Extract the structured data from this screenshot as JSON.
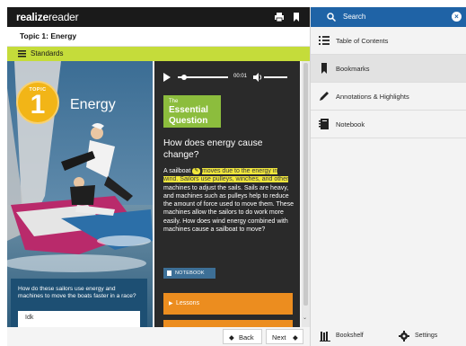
{
  "app": {
    "logo_bold": "realize",
    "logo_thin": "reader"
  },
  "topbar": {
    "print_icon": "printer-icon",
    "bookmark_icon": "bookmark-icon"
  },
  "topic_bar": {
    "title": "Topic 1: Energy"
  },
  "standards": {
    "label": "Standards"
  },
  "hero": {
    "topic_label": "TOPIC",
    "topic_number": "1",
    "title": "Energy",
    "lower_question": "How do these sailors use energy and machines to move the boats faster in a race?",
    "answer_value": "Idk"
  },
  "audio": {
    "time": "00:01"
  },
  "essential_question": {
    "line1": "The",
    "line2": "Essential",
    "line3": "Question"
  },
  "main": {
    "question": "How does energy cause change?",
    "body_start": "A sailboat",
    "body_highlight": "moves due to the energy in wind. Sailors use pulleys, winches, and other",
    "body_rest": " machines to adjust the sails. Sails are heavy, and machines such as pulleys help to reduce the amount of force used to move them. These machines allow the sailors to do work more easily. How does wind energy combined with machines cause a sailboat to move?",
    "notebook_label": "NOTEBOOK",
    "lessons_label": "Lessons"
  },
  "bottom_nav": {
    "back_label": "Back",
    "next_label": "Next"
  },
  "sidebar": {
    "search_placeholder": "Search",
    "items": [
      {
        "label": "Table of Contents",
        "icon": "list-icon"
      },
      {
        "label": "Bookmarks",
        "icon": "bookmark-icon"
      },
      {
        "label": "Annotations & Highlights",
        "icon": "pencil-icon"
      },
      {
        "label": "Notebook",
        "icon": "notebook-icon"
      }
    ],
    "bookshelf_label": "Bookshelf",
    "settings_label": "Settings"
  },
  "colors": {
    "accent_green": "#c5dc3a",
    "search_blue": "#1f63a6",
    "lessons_orange": "#ec8d1f",
    "highlight_yellow": "#f0e63c"
  }
}
